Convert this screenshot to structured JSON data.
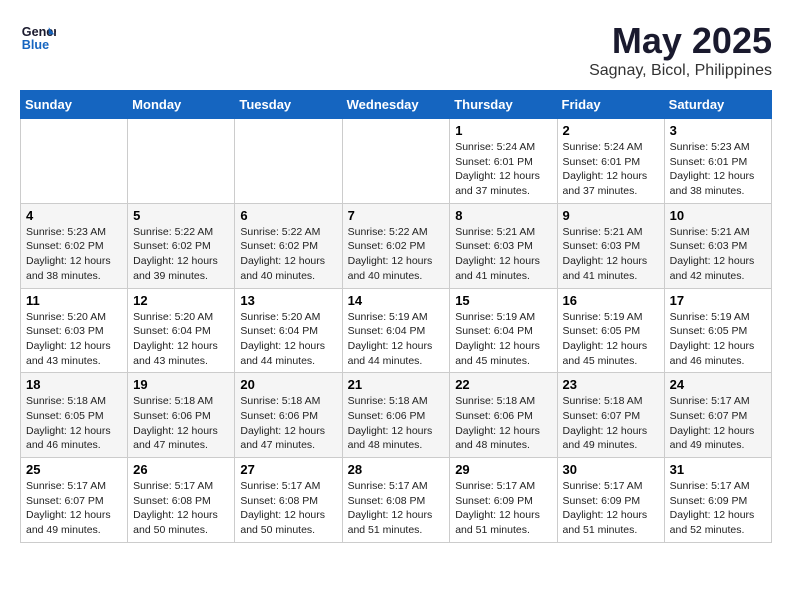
{
  "logo": {
    "line1": "General",
    "line2": "Blue"
  },
  "title": "May 2025",
  "location": "Sagnay, Bicol, Philippines",
  "days_of_week": [
    "Sunday",
    "Monday",
    "Tuesday",
    "Wednesday",
    "Thursday",
    "Friday",
    "Saturday"
  ],
  "weeks": [
    [
      {
        "day": "",
        "content": ""
      },
      {
        "day": "",
        "content": ""
      },
      {
        "day": "",
        "content": ""
      },
      {
        "day": "",
        "content": ""
      },
      {
        "day": "1",
        "content": "Sunrise: 5:24 AM\nSunset: 6:01 PM\nDaylight: 12 hours\nand 37 minutes."
      },
      {
        "day": "2",
        "content": "Sunrise: 5:24 AM\nSunset: 6:01 PM\nDaylight: 12 hours\nand 37 minutes."
      },
      {
        "day": "3",
        "content": "Sunrise: 5:23 AM\nSunset: 6:01 PM\nDaylight: 12 hours\nand 38 minutes."
      }
    ],
    [
      {
        "day": "4",
        "content": "Sunrise: 5:23 AM\nSunset: 6:02 PM\nDaylight: 12 hours\nand 38 minutes."
      },
      {
        "day": "5",
        "content": "Sunrise: 5:22 AM\nSunset: 6:02 PM\nDaylight: 12 hours\nand 39 minutes."
      },
      {
        "day": "6",
        "content": "Sunrise: 5:22 AM\nSunset: 6:02 PM\nDaylight: 12 hours\nand 40 minutes."
      },
      {
        "day": "7",
        "content": "Sunrise: 5:22 AM\nSunset: 6:02 PM\nDaylight: 12 hours\nand 40 minutes."
      },
      {
        "day": "8",
        "content": "Sunrise: 5:21 AM\nSunset: 6:03 PM\nDaylight: 12 hours\nand 41 minutes."
      },
      {
        "day": "9",
        "content": "Sunrise: 5:21 AM\nSunset: 6:03 PM\nDaylight: 12 hours\nand 41 minutes."
      },
      {
        "day": "10",
        "content": "Sunrise: 5:21 AM\nSunset: 6:03 PM\nDaylight: 12 hours\nand 42 minutes."
      }
    ],
    [
      {
        "day": "11",
        "content": "Sunrise: 5:20 AM\nSunset: 6:03 PM\nDaylight: 12 hours\nand 43 minutes."
      },
      {
        "day": "12",
        "content": "Sunrise: 5:20 AM\nSunset: 6:04 PM\nDaylight: 12 hours\nand 43 minutes."
      },
      {
        "day": "13",
        "content": "Sunrise: 5:20 AM\nSunset: 6:04 PM\nDaylight: 12 hours\nand 44 minutes."
      },
      {
        "day": "14",
        "content": "Sunrise: 5:19 AM\nSunset: 6:04 PM\nDaylight: 12 hours\nand 44 minutes."
      },
      {
        "day": "15",
        "content": "Sunrise: 5:19 AM\nSunset: 6:04 PM\nDaylight: 12 hours\nand 45 minutes."
      },
      {
        "day": "16",
        "content": "Sunrise: 5:19 AM\nSunset: 6:05 PM\nDaylight: 12 hours\nand 45 minutes."
      },
      {
        "day": "17",
        "content": "Sunrise: 5:19 AM\nSunset: 6:05 PM\nDaylight: 12 hours\nand 46 minutes."
      }
    ],
    [
      {
        "day": "18",
        "content": "Sunrise: 5:18 AM\nSunset: 6:05 PM\nDaylight: 12 hours\nand 46 minutes."
      },
      {
        "day": "19",
        "content": "Sunrise: 5:18 AM\nSunset: 6:06 PM\nDaylight: 12 hours\nand 47 minutes."
      },
      {
        "day": "20",
        "content": "Sunrise: 5:18 AM\nSunset: 6:06 PM\nDaylight: 12 hours\nand 47 minutes."
      },
      {
        "day": "21",
        "content": "Sunrise: 5:18 AM\nSunset: 6:06 PM\nDaylight: 12 hours\nand 48 minutes."
      },
      {
        "day": "22",
        "content": "Sunrise: 5:18 AM\nSunset: 6:06 PM\nDaylight: 12 hours\nand 48 minutes."
      },
      {
        "day": "23",
        "content": "Sunrise: 5:18 AM\nSunset: 6:07 PM\nDaylight: 12 hours\nand 49 minutes."
      },
      {
        "day": "24",
        "content": "Sunrise: 5:17 AM\nSunset: 6:07 PM\nDaylight: 12 hours\nand 49 minutes."
      }
    ],
    [
      {
        "day": "25",
        "content": "Sunrise: 5:17 AM\nSunset: 6:07 PM\nDaylight: 12 hours\nand 49 minutes."
      },
      {
        "day": "26",
        "content": "Sunrise: 5:17 AM\nSunset: 6:08 PM\nDaylight: 12 hours\nand 50 minutes."
      },
      {
        "day": "27",
        "content": "Sunrise: 5:17 AM\nSunset: 6:08 PM\nDaylight: 12 hours\nand 50 minutes."
      },
      {
        "day": "28",
        "content": "Sunrise: 5:17 AM\nSunset: 6:08 PM\nDaylight: 12 hours\nand 51 minutes."
      },
      {
        "day": "29",
        "content": "Sunrise: 5:17 AM\nSunset: 6:09 PM\nDaylight: 12 hours\nand 51 minutes."
      },
      {
        "day": "30",
        "content": "Sunrise: 5:17 AM\nSunset: 6:09 PM\nDaylight: 12 hours\nand 51 minutes."
      },
      {
        "day": "31",
        "content": "Sunrise: 5:17 AM\nSunset: 6:09 PM\nDaylight: 12 hours\nand 52 minutes."
      }
    ]
  ]
}
